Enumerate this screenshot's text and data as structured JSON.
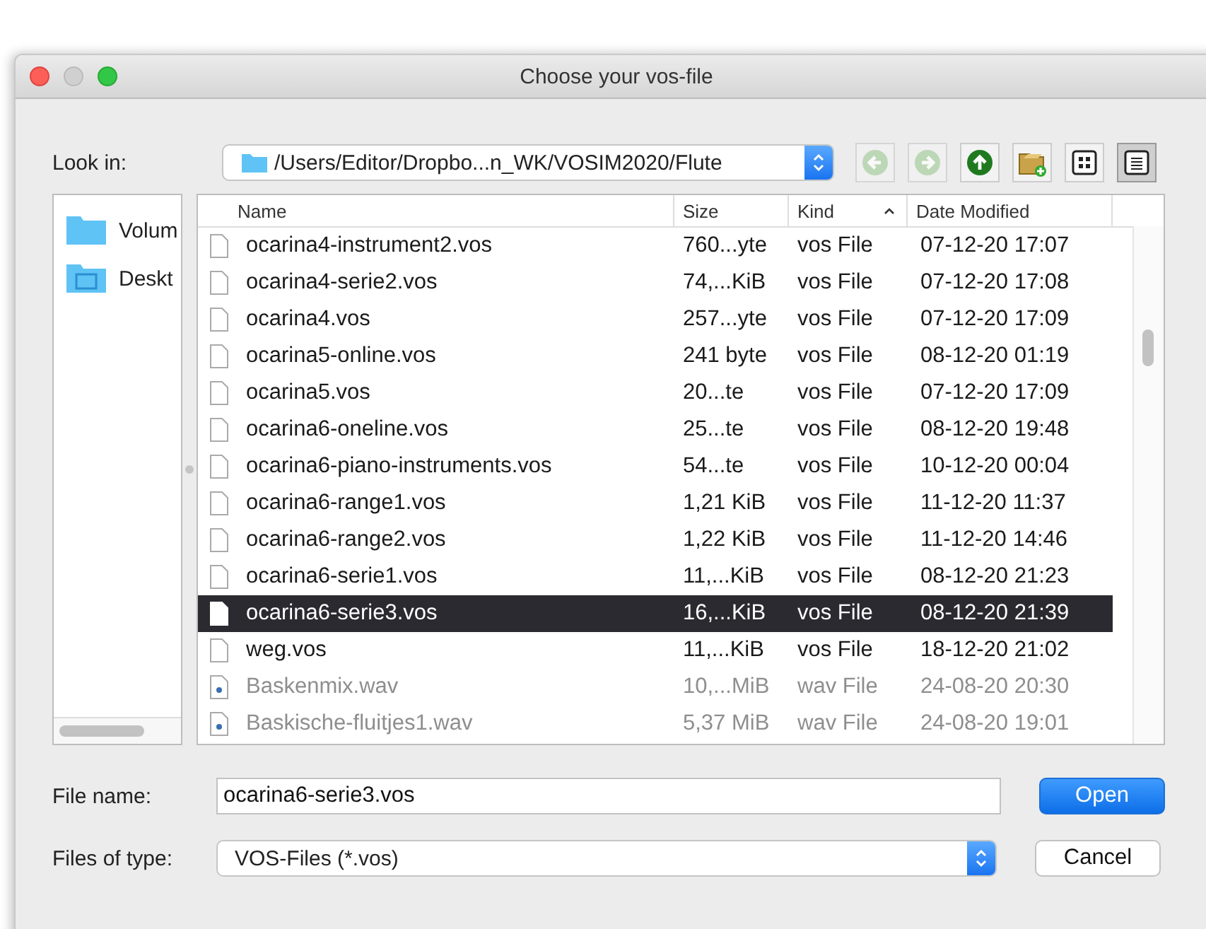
{
  "window": {
    "title": "Choose your vos-file"
  },
  "look_in": {
    "label": "Look in:",
    "path": "/Users/Editor/Dropbo...n_WK/VOSIM2020/Flute"
  },
  "toolbar": [
    {
      "kind": "back",
      "disabled": true
    },
    {
      "kind": "forward",
      "disabled": true
    },
    {
      "kind": "up",
      "disabled": false
    },
    {
      "kind": "newfolder",
      "disabled": false
    },
    {
      "kind": "icons",
      "selected": false
    },
    {
      "kind": "details",
      "selected": true
    }
  ],
  "sidebar": {
    "items": [
      {
        "label": "Volum",
        "kind": "folder"
      },
      {
        "label": "Deskt",
        "kind": "desktop"
      }
    ]
  },
  "table": {
    "columns": [
      {
        "label": "Name",
        "sorted": false
      },
      {
        "label": "Size",
        "sorted": false
      },
      {
        "label": "Kind",
        "sorted": true
      },
      {
        "label": "Date Modified",
        "sorted": false
      }
    ],
    "rows": [
      {
        "name": "ocarina4-instrument2.vos",
        "size": "760...yte",
        "kind": "vos File",
        "date": "07-12-20 17:07",
        "selected": false,
        "disabled": false
      },
      {
        "name": "ocarina4-serie2.vos",
        "size": "74,...KiB",
        "kind": "vos File",
        "date": "07-12-20 17:08",
        "selected": false,
        "disabled": false
      },
      {
        "name": "ocarina4.vos",
        "size": "257...yte",
        "kind": "vos File",
        "date": "07-12-20 17:09",
        "selected": false,
        "disabled": false
      },
      {
        "name": "ocarina5-online.vos",
        "size": "241 byte",
        "kind": "vos File",
        "date": "08-12-20 01:19",
        "selected": false,
        "disabled": false
      },
      {
        "name": "ocarina5.vos",
        "size": "20...te",
        "kind": "vos File",
        "date": "07-12-20 17:09",
        "selected": false,
        "disabled": false
      },
      {
        "name": "ocarina6-oneline.vos",
        "size": "25...te",
        "kind": "vos File",
        "date": "08-12-20 19:48",
        "selected": false,
        "disabled": false
      },
      {
        "name": "ocarina6-piano-instruments.vos",
        "size": "54...te",
        "kind": "vos File",
        "date": "10-12-20 00:04",
        "selected": false,
        "disabled": false
      },
      {
        "name": "ocarina6-range1.vos",
        "size": "1,21 KiB",
        "kind": "vos File",
        "date": "11-12-20 11:37",
        "selected": false,
        "disabled": false
      },
      {
        "name": "ocarina6-range2.vos",
        "size": "1,22 KiB",
        "kind": "vos File",
        "date": "11-12-20 14:46",
        "selected": false,
        "disabled": false
      },
      {
        "name": "ocarina6-serie1.vos",
        "size": "11,...KiB",
        "kind": "vos File",
        "date": "08-12-20 21:23",
        "selected": false,
        "disabled": false
      },
      {
        "name": "ocarina6-serie3.vos",
        "size": "16,...KiB",
        "kind": "vos File",
        "date": "08-12-20 21:39",
        "selected": true,
        "disabled": false
      },
      {
        "name": "weg.vos",
        "size": "11,...KiB",
        "kind": "vos File",
        "date": "18-12-20 21:02",
        "selected": false,
        "disabled": false
      },
      {
        "name": "Baskenmix.wav",
        "size": "10,...MiB",
        "kind": "wav File",
        "date": "24-08-20 20:30",
        "selected": false,
        "disabled": true
      },
      {
        "name": "Baskische-fluitjes1.wav",
        "size": "5,37 MiB",
        "kind": "wav File",
        "date": "24-08-20 19:01",
        "selected": false,
        "disabled": true
      }
    ]
  },
  "file_name": {
    "label": "File name:",
    "value": "ocarina6-serie3.vos"
  },
  "file_type": {
    "label": "Files of type:",
    "value": "VOS-Files (*.vos)"
  },
  "buttons": [
    {
      "label": "Open",
      "default": true
    },
    {
      "label": "Cancel",
      "default": false
    }
  ]
}
